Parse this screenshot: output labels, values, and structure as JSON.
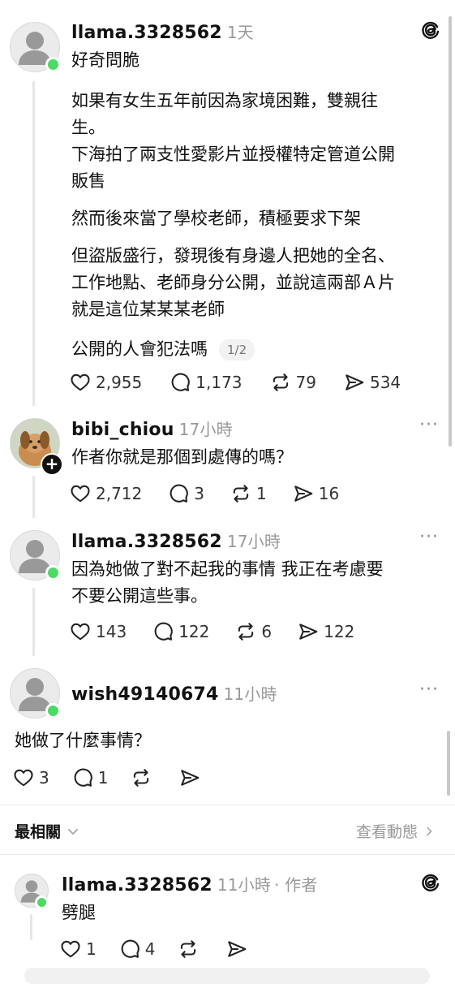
{
  "post": {
    "username": "llama.3328562",
    "time": "1天",
    "title": "好奇問脆",
    "paragraphs": [
      "如果有女生五年前因為家境困難，雙親往",
      "生。",
      "下海拍了兩支性愛影片並授權特定管道公開",
      "販售",
      "然而後來當了學校老師，積極要求下架",
      "但盜版盛行，發現後有身邊人把她的全名、",
      "工作地點、老師身分公開，並說這兩部Ａ片",
      "就是這位某某某老師",
      "公開的人會犯法嗎"
    ],
    "pager": "1/2",
    "likes": "2,955",
    "comments": "1,173",
    "reposts": "79",
    "shares": "534"
  },
  "reply1": {
    "username": "bibi_chiou",
    "time": "17小時",
    "text": "作者你就是那個到處傳的嗎？",
    "likes": "2,712",
    "comments": "3",
    "reposts": "1",
    "shares": "16",
    "more": "···"
  },
  "reply2": {
    "username": "llama.3328562",
    "time": "17小時",
    "lines": [
      "因為她做了對不起我的事情 我正在考慮要",
      "不要公開這些事。"
    ],
    "likes": "143",
    "comments": "122",
    "reposts": "6",
    "shares": "122",
    "more": "···"
  },
  "reply3": {
    "username": "wish49140674",
    "time": "11小時",
    "text": "她做了什麼事情？",
    "likes": "3",
    "comments": "1",
    "more": "···"
  },
  "sort": {
    "label": "最相關",
    "activity": "查看動態"
  },
  "reply4": {
    "username": "llama.3328562",
    "time": "11小時",
    "author_tag": "· 作者",
    "text": "劈腿",
    "likes": "1",
    "comments": "4"
  },
  "icons": {
    "threads": "threads-logo-icon",
    "like": "heart-icon",
    "comment": "comment-icon",
    "repost": "repost-icon",
    "share": "send-icon",
    "add": "plus-icon",
    "chevron": "chevron-down-icon"
  },
  "colors": {
    "online": "#4cd964",
    "meta": "#999999",
    "divider": "#e8e8e8"
  }
}
